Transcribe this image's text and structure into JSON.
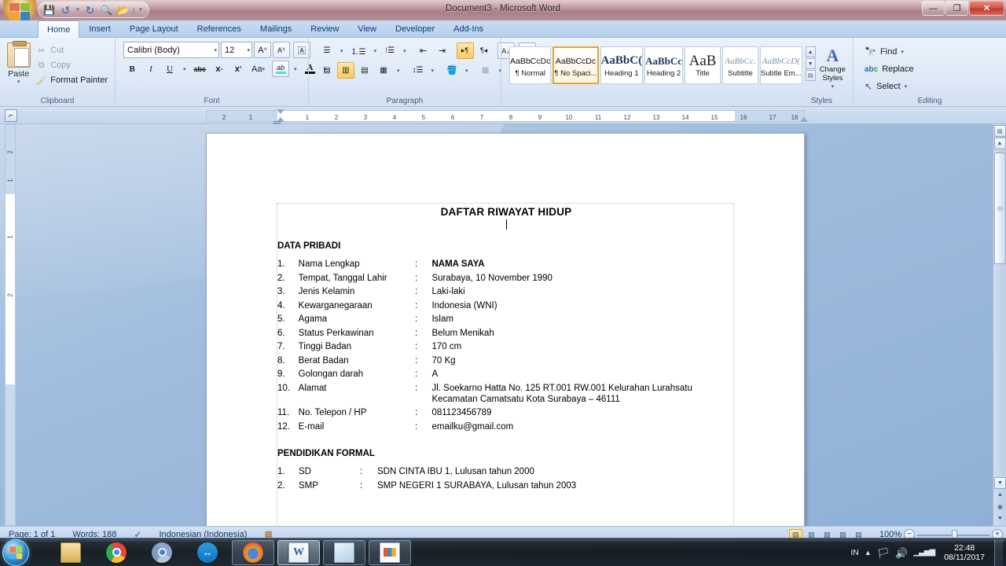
{
  "window": {
    "title": "Document3 - Microsoft Word",
    "controls": {
      "minimize": "—",
      "restore": "❐",
      "close": "✕"
    }
  },
  "quick_access": {
    "items": [
      {
        "name": "save-icon",
        "glyph": "💾"
      },
      {
        "name": "undo-icon",
        "glyph": "↺"
      },
      {
        "name": "undo-dropdown-icon",
        "glyph": "▾"
      },
      {
        "name": "redo-icon",
        "glyph": "↻"
      },
      {
        "name": "print-preview-icon",
        "glyph": "🔍"
      },
      {
        "name": "open-icon",
        "glyph": "📂"
      },
      {
        "name": "customize-qat-icon",
        "glyph": "▾"
      }
    ]
  },
  "tabs": [
    {
      "label": "Home",
      "active": true
    },
    {
      "label": "Insert",
      "active": false
    },
    {
      "label": "Page Layout",
      "active": false
    },
    {
      "label": "References",
      "active": false
    },
    {
      "label": "Mailings",
      "active": false
    },
    {
      "label": "Review",
      "active": false
    },
    {
      "label": "View",
      "active": false
    },
    {
      "label": "Developer",
      "active": false
    },
    {
      "label": "Add-Ins",
      "active": false
    }
  ],
  "ribbon": {
    "clipboard": {
      "label": "Clipboard",
      "paste": "Paste",
      "items": [
        {
          "label": "Cut",
          "icon": "scissors-icon",
          "glyph": "✂",
          "enabled": false
        },
        {
          "label": "Copy",
          "icon": "copy-icon",
          "glyph": "⧉",
          "enabled": false
        },
        {
          "label": "Format Painter",
          "icon": "format-painter-icon",
          "glyph": "🖌",
          "enabled": true
        }
      ]
    },
    "font": {
      "label": "Font",
      "font_name": "Calibri (Body)",
      "font_size": "12",
      "buttons": [
        {
          "name": "grow-font-button",
          "glyph": "A˄"
        },
        {
          "name": "shrink-font-button",
          "glyph": "A˅"
        },
        {
          "name": "clear-formatting-button",
          "glyph": "🄰"
        },
        {
          "name": "bold-button",
          "glyph": "B"
        },
        {
          "name": "italic-button",
          "glyph": "I"
        },
        {
          "name": "underline-button",
          "glyph": "U"
        },
        {
          "name": "strikethrough-button",
          "glyph": "abc"
        },
        {
          "name": "subscript-button",
          "glyph": "x₂"
        },
        {
          "name": "superscript-button",
          "glyph": "x²"
        },
        {
          "name": "change-case-button",
          "glyph": "Aa"
        },
        {
          "name": "text-highlight-button",
          "glyph": "ab"
        },
        {
          "name": "font-color-button",
          "glyph": "A"
        }
      ]
    },
    "paragraph": {
      "label": "Paragraph",
      "buttons": [
        {
          "name": "bullets-button"
        },
        {
          "name": "numbering-button"
        },
        {
          "name": "multilevel-list-button"
        },
        {
          "name": "decrease-indent-button"
        },
        {
          "name": "increase-indent-button"
        },
        {
          "name": "ltr-text-direction-button",
          "active": true
        },
        {
          "name": "rtl-text-direction-button",
          "active": false
        },
        {
          "name": "sort-button"
        },
        {
          "name": "show-formatting-marks-button"
        },
        {
          "name": "align-left-button",
          "active": false
        },
        {
          "name": "align-center-button",
          "active": true
        },
        {
          "name": "align-right-button",
          "active": false
        },
        {
          "name": "justify-button",
          "active": false
        },
        {
          "name": "line-spacing-button"
        },
        {
          "name": "shading-button"
        },
        {
          "name": "borders-button"
        }
      ]
    },
    "styles": {
      "label": "Styles",
      "gallery": [
        {
          "preview": "AaBbCcDc",
          "name": "¶ Normal",
          "kind": "black",
          "selected": false
        },
        {
          "preview": "AaBbCcDc",
          "name": "¶ No Spaci...",
          "kind": "black",
          "selected": true
        },
        {
          "preview": "AaBbC(",
          "name": "Heading 1",
          "kind": "big",
          "selected": false
        },
        {
          "preview": "AaBbCc",
          "name": "Heading 2",
          "kind": "big",
          "selected": false
        },
        {
          "preview": "AaB",
          "name": "Title",
          "kind": "title",
          "selected": false
        },
        {
          "preview": "AaBbCc.",
          "name": "Subtitle",
          "kind": "ital",
          "selected": false
        },
        {
          "preview": "AaBbCcD(",
          "name": "Subtle Em...",
          "kind": "ital",
          "selected": false
        }
      ],
      "change_styles": "Change Styles"
    },
    "editing": {
      "label": "Editing",
      "items": [
        {
          "label": "Find",
          "icon": "binoculars-icon",
          "glyph": "🔭",
          "caret": "▾"
        },
        {
          "label": "Replace",
          "icon": "replace-icon",
          "glyph": "ab",
          "caret": ""
        },
        {
          "label": "Select",
          "icon": "select-arrow-icon",
          "glyph": "↖",
          "caret": "▾"
        }
      ]
    }
  },
  "ruler": {
    "horizontal_ticks": [
      "2",
      "1",
      "1",
      "2",
      "3",
      "4",
      "5",
      "6",
      "7",
      "8",
      "9",
      "10",
      "11",
      "12",
      "13",
      "14",
      "15",
      "16",
      "17",
      "18"
    ],
    "vertical_ticks": [
      "2",
      "1",
      "1",
      "2"
    ],
    "tab_selector": "⌐"
  },
  "document": {
    "title": "DAFTAR RIWAYAT HIDUP",
    "section_personal": "DATA PRIBADI",
    "personal_rows": [
      {
        "num": "1.",
        "label": "Nama Lengkap",
        "colon": ":",
        "value": "NAMA SAYA",
        "bold": true
      },
      {
        "num": "2.",
        "label": "Tempat, Tanggal Lahir",
        "colon": ":",
        "value": "Surabaya, 10 November 1990",
        "bold": false
      },
      {
        "num": "3.",
        "label": "Jenis Kelamin",
        "colon": ":",
        "value": "Laki-laki",
        "bold": false
      },
      {
        "num": "4.",
        "label": "Kewarganegaraan",
        "colon": ":",
        "value": "Indonesia (WNI)",
        "bold": false
      },
      {
        "num": "5.",
        "label": "Agama",
        "colon": ":",
        "value": "Islam",
        "bold": false
      },
      {
        "num": "6.",
        "label": "Status Perkawinan",
        "colon": ":",
        "value": "Belum Menikah",
        "bold": false
      },
      {
        "num": "7.",
        "label": "Tinggi Badan",
        "colon": ":",
        "value": "170 cm",
        "bold": false
      },
      {
        "num": "8.",
        "label": "Berat Badan",
        "colon": ":",
        "value": "70 Kg",
        "bold": false
      },
      {
        "num": "9.",
        "label": "Golongan darah",
        "colon": ":",
        "value": "A",
        "bold": false
      },
      {
        "num": "10.",
        "label": "Alamat",
        "colon": ":",
        "value": "Jl. Soekarno Hatta No. 125 RT.001 RW.001 Kelurahan Lurahsatu Kecamatan Camatsatu Kota Surabaya – 46111",
        "bold": false
      },
      {
        "num": "11.",
        "label": "No. Telepon / HP",
        "colon": ":",
        "value": "081123456789",
        "bold": false
      },
      {
        "num": "12.",
        "label": "E-mail",
        "colon": ":",
        "value": "emailku@gmail.com",
        "bold": false
      }
    ],
    "section_education": "PENDIDIKAN FORMAL",
    "education_rows": [
      {
        "num": "1.",
        "label": "SD",
        "colon": ":",
        "value": "SDN CINTA IBU 1, Lulusan tahun 2000"
      },
      {
        "num": "2.",
        "label": "SMP",
        "colon": ":",
        "value": "SMP NEGERI 1 SURABAYA, Lulusan tahun 2003"
      }
    ]
  },
  "status_bar": {
    "page": "Page: 1 of 1",
    "words": "Words: 188",
    "proofing_icon": "proofing-errors-icon",
    "language": "Indonesian (Indonesia)",
    "macro_icon": "record-macro-icon",
    "views": [
      {
        "name": "print-layout-view-button",
        "glyph": "▤",
        "active": true
      },
      {
        "name": "full-screen-reading-view-button",
        "glyph": "▥",
        "active": false
      },
      {
        "name": "web-layout-view-button",
        "glyph": "▧",
        "active": false
      },
      {
        "name": "outline-view-button",
        "glyph": "▨",
        "active": false
      },
      {
        "name": "draft-view-button",
        "glyph": "▤",
        "active": false
      }
    ],
    "zoom": "100%",
    "zoom_out": "−",
    "zoom_in": "+"
  },
  "taskbar": {
    "start": "start-orb",
    "items": [
      {
        "name": "taskbar-file-explorer",
        "icon": "folder-icon",
        "state": "pinned"
      },
      {
        "name": "taskbar-google-chrome",
        "icon": "chrome-icon",
        "state": "pinned"
      },
      {
        "name": "taskbar-chromium",
        "icon": "chromium-icon",
        "state": "pinned"
      },
      {
        "name": "taskbar-teamviewer",
        "icon": "teamviewer-icon",
        "state": "pinned"
      },
      {
        "name": "taskbar-firefox",
        "icon": "firefox-icon",
        "state": "running"
      },
      {
        "name": "taskbar-microsoft-word",
        "icon": "word-icon",
        "state": "active"
      },
      {
        "name": "taskbar-notepad",
        "icon": "notepad-icon",
        "state": "running"
      },
      {
        "name": "taskbar-powerpoint",
        "icon": "powerpoint-icon",
        "state": "running"
      }
    ],
    "tray": {
      "language": "IN",
      "show_hidden_icons": "▲",
      "icons": [
        {
          "name": "action-center-icon",
          "glyph": "🏳"
        },
        {
          "name": "volume-icon",
          "glyph": "🔊"
        },
        {
          "name": "network-icon",
          "glyph": "▂▄▆"
        }
      ],
      "time": "22:48",
      "date": "08/11/2017"
    }
  }
}
